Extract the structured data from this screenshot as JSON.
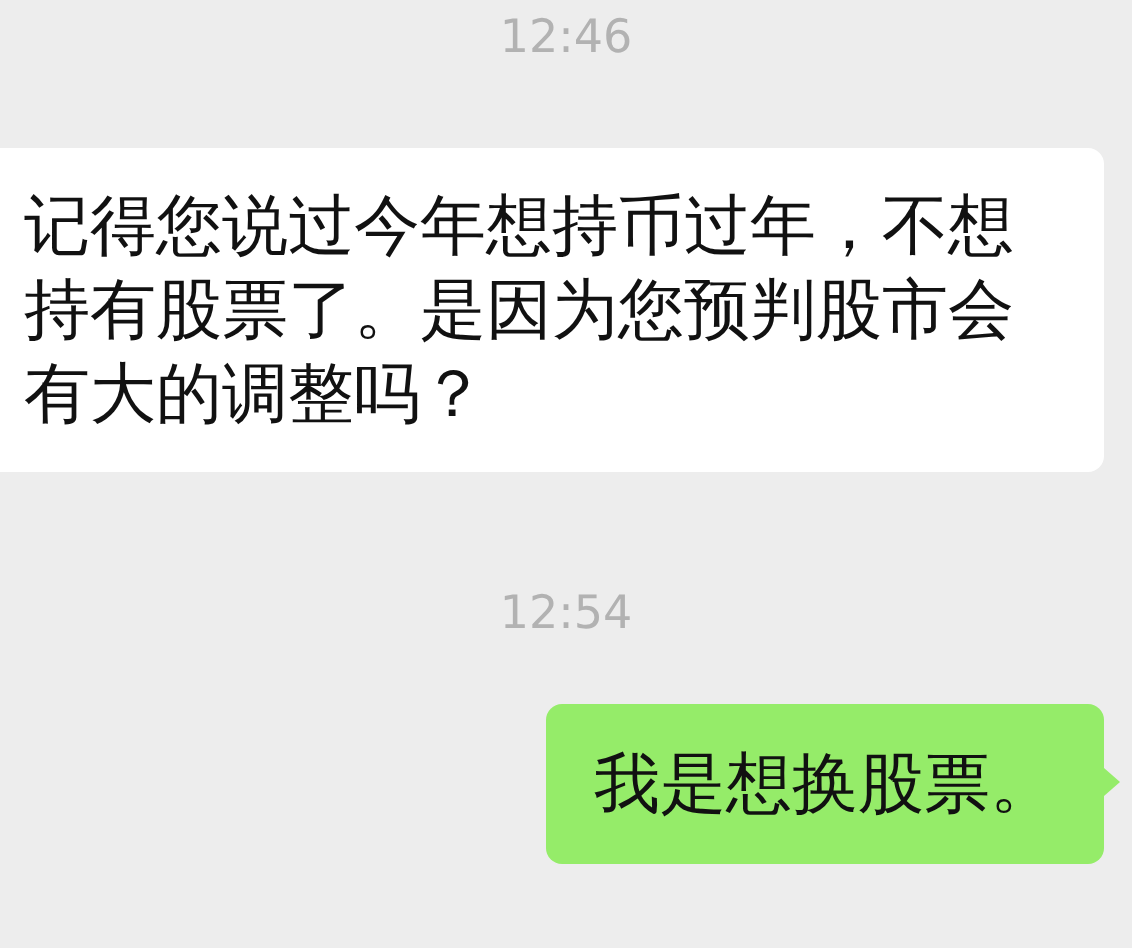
{
  "messages": [
    {
      "kind": "time",
      "text": "12:46"
    },
    {
      "kind": "received",
      "text": "记得您说过今年想持币过年，不想持有股票了。是因为您预判股市会有大的调整吗？"
    },
    {
      "kind": "time",
      "text": "12:54"
    },
    {
      "kind": "sent",
      "text": "我是想换股票。"
    }
  ]
}
